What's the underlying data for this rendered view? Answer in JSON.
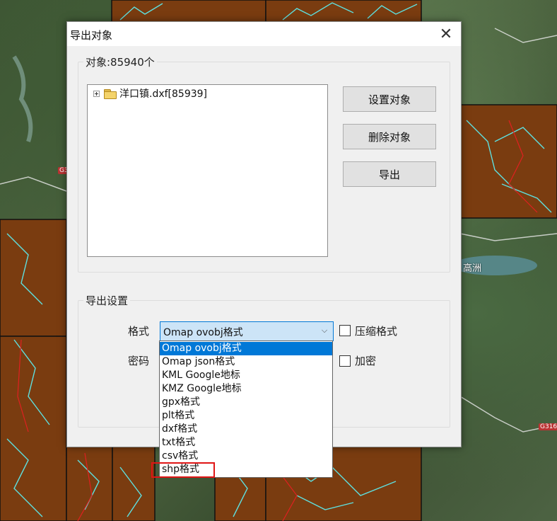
{
  "map": {
    "labels": [
      {
        "text": "高洲"
      }
    ],
    "road_shields": [
      "G3",
      "G316"
    ]
  },
  "dialog": {
    "title": "导出对象",
    "close_label": "✕",
    "objects_group": {
      "legend": "对象:85940个",
      "tree": [
        {
          "label": "洋口镇.dxf[85939]",
          "expander": "+",
          "icon": "folder-icon"
        }
      ],
      "buttons": {
        "set_objects": "设置对象",
        "delete_objects": "删除对象",
        "export": "导出"
      }
    },
    "export_settings": {
      "legend": "导出设置",
      "format_label": "格式",
      "format_value": "Omap ovobj格式",
      "password_label": "密码",
      "compress_label": "压缩格式",
      "encrypt_label": "加密",
      "compress_checked": false,
      "encrypt_checked": false,
      "format_options": [
        "Omap ovobj格式",
        "Omap json格式",
        "KML Google地标",
        "KMZ Google地标",
        "gpx格式",
        "plt格式",
        "dxf格式",
        "txt格式",
        "csv格式",
        "shp格式"
      ],
      "selected_option": "Omap ovobj格式",
      "highlighted_option": "shp格式"
    }
  },
  "colors": {
    "selection": "#0078d7",
    "highlight_box": "#e01515",
    "parcel_fill": "#7a3c10",
    "river": "#5ee0e0",
    "boundary": "#e02020"
  }
}
